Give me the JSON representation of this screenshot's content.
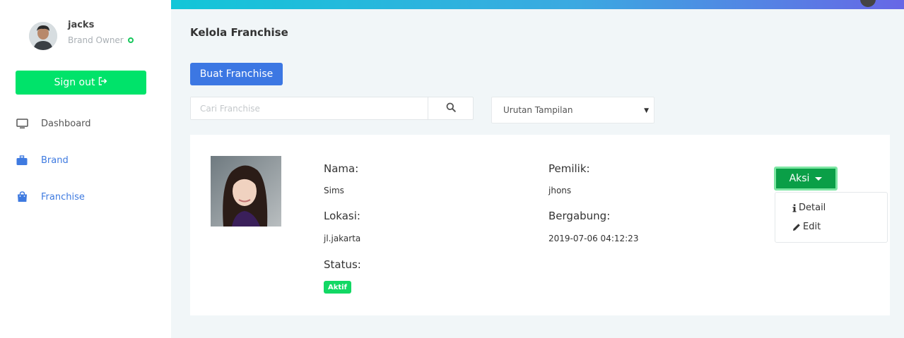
{
  "sidebar": {
    "user": {
      "name": "jacks",
      "role": "Brand Owner"
    },
    "signout_label": "Sign out",
    "nav": [
      {
        "label": "Dashboard",
        "icon": "monitor-icon"
      },
      {
        "label": "Brand",
        "icon": "briefcase-icon"
      },
      {
        "label": "Franchise",
        "icon": "shopping-bag-icon"
      }
    ]
  },
  "main": {
    "title": "Kelola Franchise",
    "create_button": "Buat Franchise",
    "search": {
      "placeholder": "Cari Franchise",
      "icon": "search-icon"
    },
    "sort": {
      "selected": "Urutan Tampilan"
    }
  },
  "franchise": {
    "nama_label": "Nama:",
    "nama": "Sims",
    "pemilik_label": "Pemilik:",
    "pemilik": "jhons",
    "lokasi_label": "Lokasi:",
    "lokasi": "jl.jakarta",
    "bergabung_label": "Bergabung:",
    "bergabung": "2019-07-06 04:12:23",
    "status_label": "Status:",
    "status": "Aktif"
  },
  "actions": {
    "button": "Aksi",
    "items": [
      {
        "label": "Detail",
        "icon": "info-icon"
      },
      {
        "label": "Edit",
        "icon": "pencil-icon"
      }
    ]
  },
  "colors": {
    "accent_green": "#00e36a",
    "primary_blue": "#3c77e3",
    "nav_blue": "#3e7ae0",
    "badge_green": "#12d864",
    "aksi_green": "#0a9f47"
  }
}
